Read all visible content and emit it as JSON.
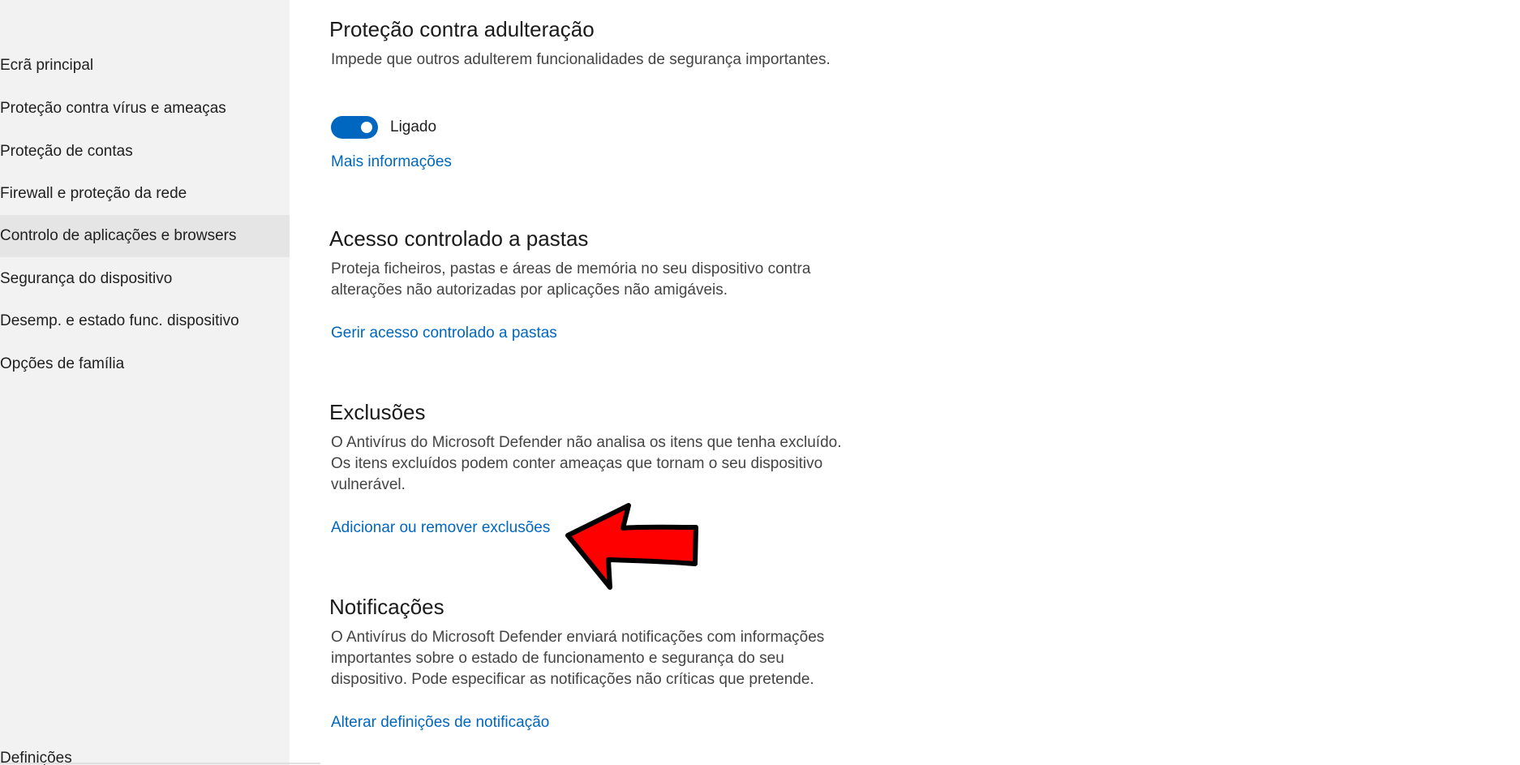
{
  "sidebar": {
    "items": [
      {
        "label": "Ecrã principal",
        "selected": false
      },
      {
        "label": "Proteção contra vírus e ameaças",
        "selected": false
      },
      {
        "label": "Proteção de contas",
        "selected": false
      },
      {
        "label": "Firewall e proteção da rede",
        "selected": false
      },
      {
        "label": "Controlo de aplicações e browsers",
        "selected": true
      },
      {
        "label": "Segurança do dispositivo",
        "selected": false
      },
      {
        "label": "Desemp. e estado func. dispositivo",
        "selected": false
      },
      {
        "label": "Opções de família",
        "selected": false
      }
    ],
    "settings_label": "Definições"
  },
  "sections": {
    "tamper": {
      "title": "Proteção contra adulteração",
      "description": "Impede que outros adulterem funcionalidades de segurança importantes.",
      "toggle_state": "on",
      "toggle_label": "Ligado",
      "link": "Mais informações"
    },
    "folder_access": {
      "title": "Acesso controlado a pastas",
      "description": "Proteja ficheiros, pastas e áreas de memória no seu dispositivo contra alterações não autorizadas por aplicações não amigáveis.",
      "link": "Gerir acesso controlado a pastas"
    },
    "exclusions": {
      "title": "Exclusões",
      "description": "O Antivírus do Microsoft Defender não analisa os itens que tenha excluído. Os itens excluídos podem conter ameaças que tornam o seu dispositivo vulnerável.",
      "link": "Adicionar ou remover exclusões"
    },
    "notifications": {
      "title": "Notificações",
      "description": "O Antivírus do Microsoft Defender enviará notificações com informações importantes sobre o estado de funcionamento e segurança do seu dispositivo. Pode especificar as notificações não críticas que pretende.",
      "link": "Alterar definições de notificação"
    }
  },
  "colors": {
    "accent": "#0067c0",
    "sidebar_bg": "#f2f2f2",
    "sidebar_selected_bg": "#e5e5e5",
    "arrow_fill": "#ff0000",
    "arrow_stroke": "#000000"
  },
  "annotation": {
    "icon": "red-arrow-icon",
    "points_to": "Adicionar ou remover exclusões"
  }
}
